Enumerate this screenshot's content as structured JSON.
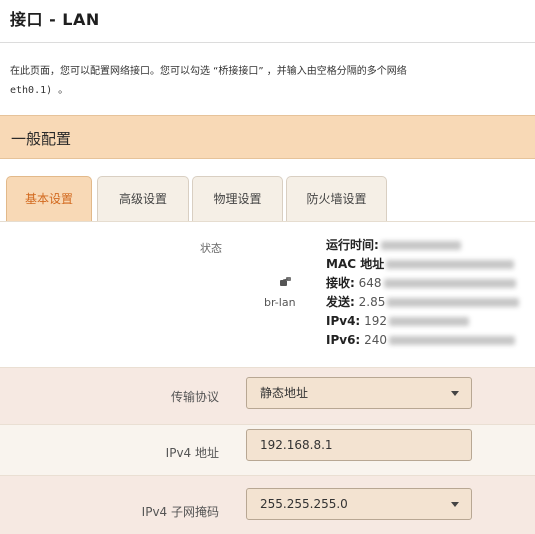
{
  "page": {
    "title": "接口 - LAN",
    "description_line1": "在此页面，您可以配置网络接口。您可以勾选 “桥接接口” ，并输入由空格分隔的多个网络",
    "description_line2": "eth0.1) 。"
  },
  "section": {
    "title": "一般配置"
  },
  "tabs": [
    {
      "label": "基本设置",
      "active": true
    },
    {
      "label": "高级设置",
      "active": false
    },
    {
      "label": "物理设置",
      "active": false
    },
    {
      "label": "防火墙设置",
      "active": false
    }
  ],
  "status": {
    "label": "状态",
    "interface_icon": "network-port-icon",
    "interface_name": "br-lan",
    "lines": [
      {
        "key": "运行时间:",
        "value": ""
      },
      {
        "key": "MAC 地址",
        "value": ""
      },
      {
        "key": "接收:",
        "value": "648"
      },
      {
        "key": "发送:",
        "value": "2.85"
      },
      {
        "key": "IPv4:",
        "value": "192"
      },
      {
        "key": "IPv6:",
        "value": "240"
      }
    ]
  },
  "form": {
    "protocol": {
      "label": "传输协议",
      "value": "静态地址"
    },
    "ipv4_address": {
      "label": "IPv4 地址",
      "value": "192.168.8.1"
    },
    "ipv4_netmask": {
      "label": "IPv4 子网掩码",
      "value": "255.255.255.0"
    }
  },
  "colors": {
    "accent": "#d2691e",
    "section_bg": "#f8d9b6",
    "row_shade": "#f6e9e2"
  }
}
